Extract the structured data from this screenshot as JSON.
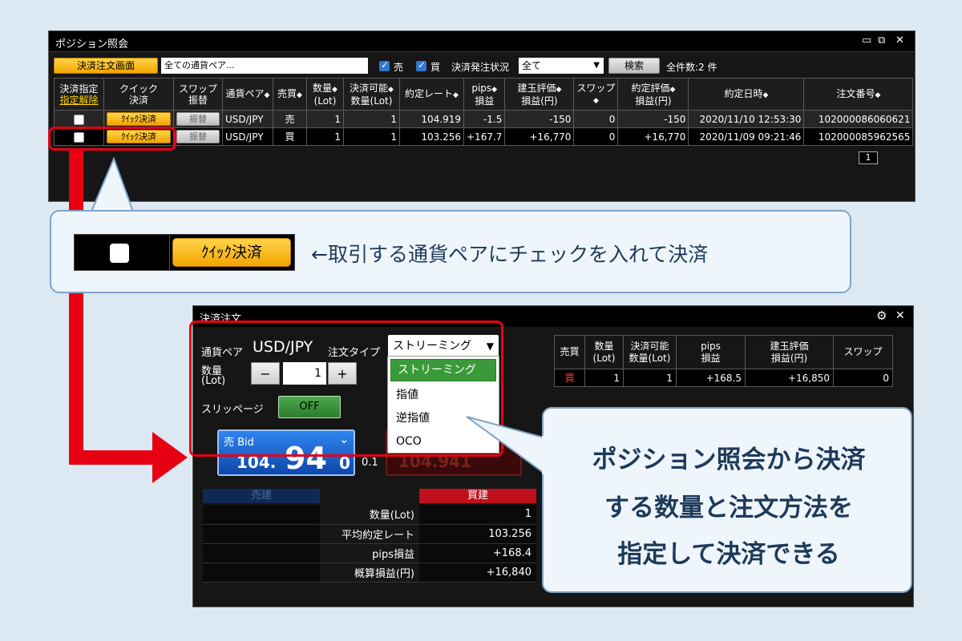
{
  "position_window": {
    "title": "ポジション照会",
    "controls": [
      "▭",
      "⧉",
      "✕"
    ],
    "toolbar": {
      "order_screen_button": "決済注文画面",
      "currency_filter_value": "全ての通貨ペア...",
      "sell_checkbox_label": "売",
      "buy_checkbox_label": "買",
      "status_label": "決済発注状況",
      "status_select_value": "全て",
      "search_button": "検索",
      "count_text": "全件数:2 件"
    },
    "columns": [
      {
        "line1": "決済指定",
        "line2": "指定解除"
      },
      {
        "line1": "クイック",
        "line2": "決済"
      },
      {
        "line1": "スワップ",
        "line2": "振替"
      },
      {
        "line1": "通貨ペア",
        "line2": ""
      },
      {
        "line1": "売買",
        "line2": ""
      },
      {
        "line1": "数量",
        "line2": "(Lot)"
      },
      {
        "line1": "決済可能",
        "line2": "数量(Lot)"
      },
      {
        "line1": "約定レート",
        "line2": ""
      },
      {
        "line1": "pips",
        "line2": "損益"
      },
      {
        "line1": "建玉評価",
        "line2": "損益(円)"
      },
      {
        "line1": "スワップ",
        "line2": ""
      },
      {
        "line1": "約定評価",
        "line2": "損益(円)"
      },
      {
        "line1": "約定日時",
        "line2": ""
      },
      {
        "line1": "注文番号",
        "line2": ""
      }
    ],
    "rows": [
      {
        "quick": "ｸｲｯｸ決済",
        "swap_btn": "振替",
        "pair": "USD/JPY",
        "side": "売",
        "qty": "1",
        "closable": "1",
        "rate": "104.919",
        "pips": "-1.5",
        "eval": "-150",
        "swap": "0",
        "exec_eval": "-150",
        "datetime": "2020/11/10 12:53:30",
        "order_no": "102000086060621"
      },
      {
        "quick": "ｸｲｯｸ決済",
        "swap_btn": "振替",
        "pair": "USD/JPY",
        "side": "買",
        "qty": "1",
        "closable": "1",
        "rate": "103.256",
        "pips": "+167.7",
        "eval": "+16,770",
        "swap": "0",
        "exec_eval": "+16,770",
        "datetime": "2020/11/09 09:21:46",
        "order_no": "102000085962565"
      }
    ],
    "page": "1"
  },
  "callout1": {
    "quick_button": "ｸｲｯｸ決済",
    "text": "←取引する通貨ペアにチェックを入れて決済"
  },
  "order_window": {
    "title": "決済注文",
    "pair_label": "通貨ペア",
    "pair_value": "USD/JPY",
    "order_type_label": "注文タイプ",
    "order_type_value": "ストリーミング",
    "order_type_options": [
      "ストリーミング",
      "指値",
      "逆指値",
      "OCO"
    ],
    "qty_label_1": "数量",
    "qty_label_2": "(Lot)",
    "qty_minus": "−",
    "qty_value": "1",
    "qty_plus": "+",
    "slippage_label": "スリッページ",
    "slippage_value": "OFF",
    "bid_label": "売 Bid",
    "bid_small": "104.",
    "bid_big": "94",
    "bid_last": "0",
    "spread": "0.1",
    "ask_price": "104.941",
    "summary": {
      "headers": [
        {
          "line1": "売買",
          "line2": ""
        },
        {
          "line1": "数量",
          "line2": "(Lot)"
        },
        {
          "line1": "決済可能",
          "line2": "数量(Lot)"
        },
        {
          "line1": "pips",
          "line2": "損益"
        },
        {
          "line1": "建玉評価",
          "line2": "損益(円)"
        },
        {
          "line1": "スワップ",
          "line2": ""
        }
      ],
      "row": {
        "side": "買",
        "qty": "1",
        "closable": "1",
        "pips": "+168.5",
        "eval": "+16,850",
        "swap": "0"
      }
    },
    "detail": {
      "sell_header": "売建",
      "buy_header": "買建",
      "rows": [
        {
          "label": "数量(Lot)",
          "value": "1"
        },
        {
          "label": "平均約定レート",
          "value": "103.256"
        },
        {
          "label": "pips損益",
          "value": "+168.4"
        },
        {
          "label": "概算損益(円)",
          "value": "+16,840"
        }
      ]
    }
  },
  "callout2": {
    "line1": "ポジション照会から決済",
    "line2": "する数量と注文方法を",
    "line3": "指定して決済できる"
  },
  "colors": {
    "accent_red": "#e60012",
    "orange": "#f2a500",
    "green": "#3a9a3a",
    "blue": "#1e64d2",
    "bg": "#dce9f3"
  }
}
